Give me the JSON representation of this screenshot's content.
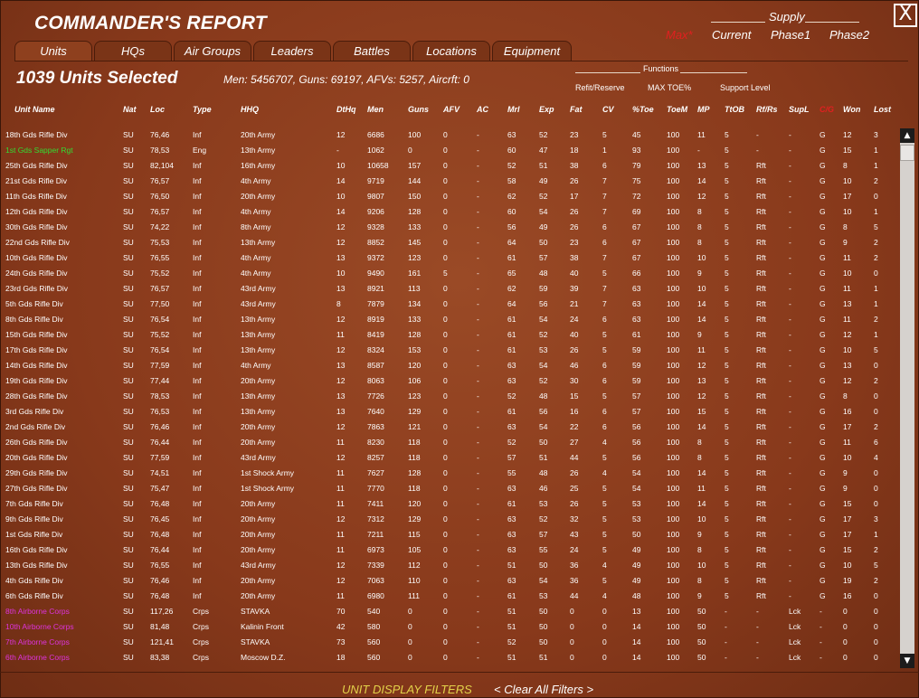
{
  "window": {
    "title": "COMMANDER'S REPORT",
    "close_label": "X"
  },
  "supply": {
    "title": "Supply",
    "options": [
      "Max*",
      "Current",
      "Phase1",
      "Phase2"
    ],
    "selected_color": "#e02020"
  },
  "tabs": [
    "Units",
    "HQs",
    "Air Groups",
    "Leaders",
    "Battles",
    "Locations",
    "Equipment"
  ],
  "summary": {
    "count": "1039 Units Selected",
    "stats": "Men: 5456707, Guns: 69197, AFVs: 5257, Aircrft: 0"
  },
  "functions": {
    "title": "Functions",
    "options": [
      "Refit/Reserve",
      "MAX TOE%",
      "Support Level"
    ]
  },
  "columns": [
    "Unit Name",
    "Nat",
    "Loc",
    "Type",
    "HHQ",
    "DtHq",
    "Men",
    "Guns",
    "AFV",
    "AC",
    "Mrl",
    "Exp",
    "Fat",
    "CV",
    "%Toe",
    "ToeM",
    "MP",
    "TtOB",
    "Rf/Rs",
    "SupL",
    "C/G",
    "Won",
    "Lost"
  ],
  "highlight_column": "C/G",
  "colors": {
    "highlight_header": "#e02020",
    "green_unit": "#33dd33",
    "magenta_unit": "#dd33dd",
    "filters_label": "#e3d24a"
  },
  "rows": [
    {
      "c": [
        "18th Gds Rifle Div",
        "SU",
        "76,46",
        "Inf",
        "20th Army",
        "12",
        "6686",
        "100",
        "0",
        "-",
        "63",
        "52",
        "23",
        "5",
        "45",
        "100",
        "11",
        "5",
        "-",
        "-",
        "G",
        "12",
        "3"
      ],
      "color": "white"
    },
    {
      "c": [
        "1st Gds Sapper Rgt",
        "SU",
        "78,53",
        "Eng",
        "13th Army",
        "-",
        "1062",
        "0",
        "0",
        "-",
        "60",
        "47",
        "18",
        "1",
        "93",
        "100",
        "-",
        "5",
        "-",
        "-",
        "G",
        "15",
        "1"
      ],
      "color": "green"
    },
    {
      "c": [
        "25th Gds Rifle Div",
        "SU",
        "82,104",
        "Inf",
        "16th Army",
        "10",
        "10658",
        "157",
        "0",
        "-",
        "52",
        "51",
        "38",
        "6",
        "79",
        "100",
        "13",
        "5",
        "Rft",
        "-",
        "G",
        "8",
        "1"
      ],
      "color": "white"
    },
    {
      "c": [
        "21st Gds Rifle Div",
        "SU",
        "76,57",
        "Inf",
        "4th Army",
        "14",
        "9719",
        "144",
        "0",
        "-",
        "58",
        "49",
        "26",
        "7",
        "75",
        "100",
        "14",
        "5",
        "Rft",
        "-",
        "G",
        "10",
        "2"
      ],
      "color": "white"
    },
    {
      "c": [
        "11th Gds Rifle Div",
        "SU",
        "76,50",
        "Inf",
        "20th Army",
        "10",
        "9807",
        "150",
        "0",
        "-",
        "62",
        "52",
        "17",
        "7",
        "72",
        "100",
        "12",
        "5",
        "Rft",
        "-",
        "G",
        "17",
        "0"
      ],
      "color": "white"
    },
    {
      "c": [
        "12th Gds Rifle Div",
        "SU",
        "76,57",
        "Inf",
        "4th Army",
        "14",
        "9206",
        "128",
        "0",
        "-",
        "60",
        "54",
        "26",
        "7",
        "69",
        "100",
        "8",
        "5",
        "Rft",
        "-",
        "G",
        "10",
        "1"
      ],
      "color": "white"
    },
    {
      "c": [
        "30th Gds Rifle Div",
        "SU",
        "74,22",
        "Inf",
        "8th Army",
        "12",
        "9328",
        "133",
        "0",
        "-",
        "56",
        "49",
        "26",
        "6",
        "67",
        "100",
        "8",
        "5",
        "Rft",
        "-",
        "G",
        "8",
        "5"
      ],
      "color": "white"
    },
    {
      "c": [
        "22nd Gds Rifle Div",
        "SU",
        "75,53",
        "Inf",
        "13th Army",
        "12",
        "8852",
        "145",
        "0",
        "-",
        "64",
        "50",
        "23",
        "6",
        "67",
        "100",
        "8",
        "5",
        "Rft",
        "-",
        "G",
        "9",
        "2"
      ],
      "color": "white"
    },
    {
      "c": [
        "10th Gds Rifle Div",
        "SU",
        "76,55",
        "Inf",
        "4th Army",
        "13",
        "9372",
        "123",
        "0",
        "-",
        "61",
        "57",
        "38",
        "7",
        "67",
        "100",
        "10",
        "5",
        "Rft",
        "-",
        "G",
        "11",
        "2"
      ],
      "color": "white"
    },
    {
      "c": [
        "24th Gds Rifle Div",
        "SU",
        "75,52",
        "Inf",
        "4th Army",
        "10",
        "9490",
        "161",
        "5",
        "-",
        "65",
        "48",
        "40",
        "5",
        "66",
        "100",
        "9",
        "5",
        "Rft",
        "-",
        "G",
        "10",
        "0"
      ],
      "color": "white"
    },
    {
      "c": [
        "23rd Gds Rifle Div",
        "SU",
        "76,57",
        "Inf",
        "43rd Army",
        "13",
        "8921",
        "113",
        "0",
        "-",
        "62",
        "59",
        "39",
        "7",
        "63",
        "100",
        "10",
        "5",
        "Rft",
        "-",
        "G",
        "11",
        "1"
      ],
      "color": "white"
    },
    {
      "c": [
        "5th Gds Rifle Div",
        "SU",
        "77,50",
        "Inf",
        "43rd Army",
        "8",
        "7879",
        "134",
        "0",
        "-",
        "64",
        "56",
        "21",
        "7",
        "63",
        "100",
        "14",
        "5",
        "Rft",
        "-",
        "G",
        "13",
        "1"
      ],
      "color": "white"
    },
    {
      "c": [
        "8th Gds Rifle Div",
        "SU",
        "76,54",
        "Inf",
        "13th Army",
        "12",
        "8919",
        "133",
        "0",
        "-",
        "61",
        "54",
        "24",
        "6",
        "63",
        "100",
        "14",
        "5",
        "Rft",
        "-",
        "G",
        "11",
        "2"
      ],
      "color": "white"
    },
    {
      "c": [
        "15th Gds Rifle Div",
        "SU",
        "75,52",
        "Inf",
        "13th Army",
        "11",
        "8419",
        "128",
        "0",
        "-",
        "61",
        "52",
        "40",
        "5",
        "61",
        "100",
        "9",
        "5",
        "Rft",
        "-",
        "G",
        "12",
        "1"
      ],
      "color": "white"
    },
    {
      "c": [
        "17th Gds Rifle Div",
        "SU",
        "76,54",
        "Inf",
        "13th Army",
        "12",
        "8324",
        "153",
        "0",
        "-",
        "61",
        "53",
        "26",
        "5",
        "59",
        "100",
        "11",
        "5",
        "Rft",
        "-",
        "G",
        "10",
        "5"
      ],
      "color": "white"
    },
    {
      "c": [
        "14th Gds Rifle Div",
        "SU",
        "77,59",
        "Inf",
        "4th Army",
        "13",
        "8587",
        "120",
        "0",
        "-",
        "63",
        "54",
        "46",
        "6",
        "59",
        "100",
        "12",
        "5",
        "Rft",
        "-",
        "G",
        "13",
        "0"
      ],
      "color": "white"
    },
    {
      "c": [
        "19th Gds Rifle Div",
        "SU",
        "77,44",
        "Inf",
        "20th Army",
        "12",
        "8063",
        "106",
        "0",
        "-",
        "63",
        "52",
        "30",
        "6",
        "59",
        "100",
        "13",
        "5",
        "Rft",
        "-",
        "G",
        "12",
        "2"
      ],
      "color": "white"
    },
    {
      "c": [
        "28th Gds Rifle Div",
        "SU",
        "78,53",
        "Inf",
        "13th Army",
        "13",
        "7726",
        "123",
        "0",
        "-",
        "52",
        "48",
        "15",
        "5",
        "57",
        "100",
        "12",
        "5",
        "Rft",
        "-",
        "G",
        "8",
        "0"
      ],
      "color": "white"
    },
    {
      "c": [
        "3rd Gds Rifle Div",
        "SU",
        "76,53",
        "Inf",
        "13th Army",
        "13",
        "7640",
        "129",
        "0",
        "-",
        "61",
        "56",
        "16",
        "6",
        "57",
        "100",
        "15",
        "5",
        "Rft",
        "-",
        "G",
        "16",
        "0"
      ],
      "color": "white"
    },
    {
      "c": [
        "2nd Gds Rifle Div",
        "SU",
        "76,46",
        "Inf",
        "20th Army",
        "12",
        "7863",
        "121",
        "0",
        "-",
        "63",
        "54",
        "22",
        "6",
        "56",
        "100",
        "14",
        "5",
        "Rft",
        "-",
        "G",
        "17",
        "2"
      ],
      "color": "white"
    },
    {
      "c": [
        "26th Gds Rifle Div",
        "SU",
        "76,44",
        "Inf",
        "20th Army",
        "11",
        "8230",
        "118",
        "0",
        "-",
        "52",
        "50",
        "27",
        "4",
        "56",
        "100",
        "8",
        "5",
        "Rft",
        "-",
        "G",
        "11",
        "6"
      ],
      "color": "white"
    },
    {
      "c": [
        "20th Gds Rifle Div",
        "SU",
        "77,59",
        "Inf",
        "43rd Army",
        "12",
        "8257",
        "118",
        "0",
        "-",
        "57",
        "51",
        "44",
        "5",
        "56",
        "100",
        "8",
        "5",
        "Rft",
        "-",
        "G",
        "10",
        "4"
      ],
      "color": "white"
    },
    {
      "c": [
        "29th Gds Rifle Div",
        "SU",
        "74,51",
        "Inf",
        "1st Shock Army",
        "11",
        "7627",
        "128",
        "0",
        "-",
        "55",
        "48",
        "26",
        "4",
        "54",
        "100",
        "14",
        "5",
        "Rft",
        "-",
        "G",
        "9",
        "0"
      ],
      "color": "white"
    },
    {
      "c": [
        "27th Gds Rifle Div",
        "SU",
        "75,47",
        "Inf",
        "1st Shock Army",
        "11",
        "7770",
        "118",
        "0",
        "-",
        "63",
        "46",
        "25",
        "5",
        "54",
        "100",
        "11",
        "5",
        "Rft",
        "-",
        "G",
        "9",
        "0"
      ],
      "color": "white"
    },
    {
      "c": [
        "7th Gds Rifle Div",
        "SU",
        "76,48",
        "Inf",
        "20th Army",
        "11",
        "7411",
        "120",
        "0",
        "-",
        "61",
        "53",
        "26",
        "5",
        "53",
        "100",
        "14",
        "5",
        "Rft",
        "-",
        "G",
        "15",
        "0"
      ],
      "color": "white"
    },
    {
      "c": [
        "9th Gds Rifle Div",
        "SU",
        "76,45",
        "Inf",
        "20th Army",
        "12",
        "7312",
        "129",
        "0",
        "-",
        "63",
        "52",
        "32",
        "5",
        "53",
        "100",
        "10",
        "5",
        "Rft",
        "-",
        "G",
        "17",
        "3"
      ],
      "color": "white"
    },
    {
      "c": [
        "1st Gds Rifle Div",
        "SU",
        "76,48",
        "Inf",
        "20th Army",
        "11",
        "7211",
        "115",
        "0",
        "-",
        "63",
        "57",
        "43",
        "5",
        "50",
        "100",
        "9",
        "5",
        "Rft",
        "-",
        "G",
        "17",
        "1"
      ],
      "color": "white"
    },
    {
      "c": [
        "16th Gds Rifle Div",
        "SU",
        "76,44",
        "Inf",
        "20th Army",
        "11",
        "6973",
        "105",
        "0",
        "-",
        "63",
        "55",
        "24",
        "5",
        "49",
        "100",
        "8",
        "5",
        "Rft",
        "-",
        "G",
        "15",
        "2"
      ],
      "color": "white"
    },
    {
      "c": [
        "13th Gds Rifle Div",
        "SU",
        "76,55",
        "Inf",
        "43rd Army",
        "12",
        "7339",
        "112",
        "0",
        "-",
        "51",
        "50",
        "36",
        "4",
        "49",
        "100",
        "10",
        "5",
        "Rft",
        "-",
        "G",
        "10",
        "5"
      ],
      "color": "white"
    },
    {
      "c": [
        "4th Gds Rifle Div",
        "SU",
        "76,46",
        "Inf",
        "20th Army",
        "12",
        "7063",
        "110",
        "0",
        "-",
        "63",
        "54",
        "36",
        "5",
        "49",
        "100",
        "8",
        "5",
        "Rft",
        "-",
        "G",
        "19",
        "2"
      ],
      "color": "white"
    },
    {
      "c": [
        "6th Gds Rifle Div",
        "SU",
        "76,48",
        "Inf",
        "20th Army",
        "11",
        "6980",
        "111",
        "0",
        "-",
        "61",
        "53",
        "44",
        "4",
        "48",
        "100",
        "9",
        "5",
        "Rft",
        "-",
        "G",
        "16",
        "0"
      ],
      "color": "white"
    },
    {
      "c": [
        "8th Airborne Corps",
        "SU",
        "117,26",
        "Crps",
        "STAVKA",
        "70",
        "540",
        "0",
        "0",
        "-",
        "51",
        "50",
        "0",
        "0",
        "13",
        "100",
        "50",
        "-",
        "-",
        "Lck",
        "-",
        "0",
        "0"
      ],
      "color": "magenta"
    },
    {
      "c": [
        "10th Airborne Corps",
        "SU",
        "81,48",
        "Crps",
        "Kalinin Front",
        "42",
        "580",
        "0",
        "0",
        "-",
        "51",
        "50",
        "0",
        "0",
        "14",
        "100",
        "50",
        "-",
        "-",
        "Lck",
        "-",
        "0",
        "0"
      ],
      "color": "magenta"
    },
    {
      "c": [
        "7th Airborne Corps",
        "SU",
        "121,41",
        "Crps",
        "STAVKA",
        "73",
        "560",
        "0",
        "0",
        "-",
        "52",
        "50",
        "0",
        "0",
        "14",
        "100",
        "50",
        "-",
        "-",
        "Lck",
        "-",
        "0",
        "0"
      ],
      "color": "magenta"
    },
    {
      "c": [
        "6th Airborne Corps",
        "SU",
        "83,38",
        "Crps",
        "Moscow D.Z.",
        "18",
        "560",
        "0",
        "0",
        "-",
        "51",
        "51",
        "0",
        "0",
        "14",
        "100",
        "50",
        "-",
        "-",
        "Lck",
        "-",
        "0",
        "0"
      ],
      "color": "magenta"
    }
  ],
  "footer": {
    "filters_label": "UNIT DISPLAY FILTERS",
    "clear_label": "< Clear All Filters >"
  }
}
